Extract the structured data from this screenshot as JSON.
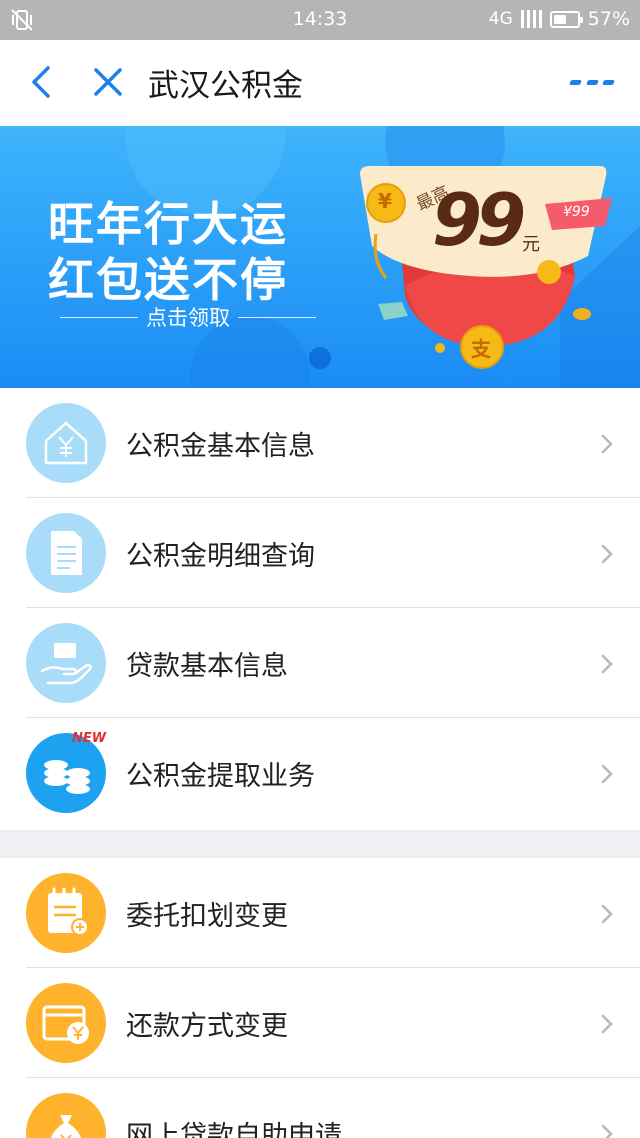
{
  "status_bar": {
    "time": "14:33",
    "network": "4G",
    "battery": "57%",
    "battery_level": 0.57,
    "left_icon": "vibrate-mute-icon"
  },
  "nav": {
    "title": "武汉公积金",
    "back_icon": "back-chevron-icon",
    "close_icon": "close-icon",
    "more_icon": "more-dots-icon",
    "accent": "#1e80e8"
  },
  "banner": {
    "line1": "旺年行大运",
    "line2": "红包送不停",
    "cta": "点击领取",
    "envelope": {
      "prefix": "最高",
      "amount": "99",
      "unit": "元",
      "tag": "¥99",
      "coin_symbol": "¥",
      "bottom_coin": "支"
    }
  },
  "menu_primary": [
    {
      "label": "公积金基本信息",
      "icon": "house-yuan-icon"
    },
    {
      "label": "公积金明细查询",
      "icon": "document-icon"
    },
    {
      "label": "贷款基本信息",
      "icon": "hand-money-icon"
    },
    {
      "label": "公积金提取业务",
      "icon": "coin-stack-icon",
      "badge": "NEW"
    }
  ],
  "menu_secondary": [
    {
      "label": "委托扣划变更",
      "icon": "notepad-icon"
    },
    {
      "label": "还款方式变更",
      "icon": "card-yuan-icon"
    },
    {
      "label": "网上贷款自助申请",
      "icon": "money-bag-icon"
    }
  ],
  "colors": {
    "banner_blue": "#1a8cf5",
    "icon_light_blue": "#a8dcf8",
    "icon_blue": "#1da2f1",
    "icon_orange": "#ffb32d",
    "badge_red": "#e03030"
  }
}
